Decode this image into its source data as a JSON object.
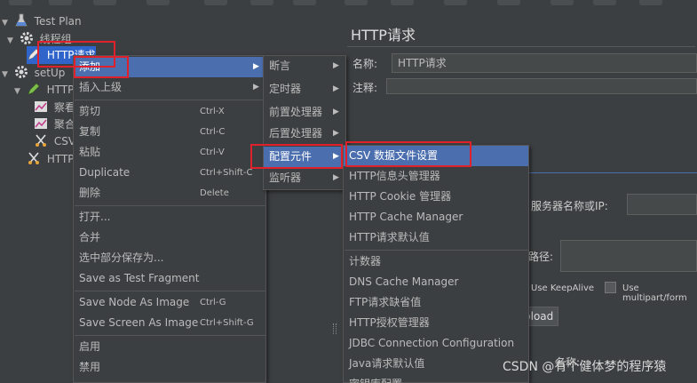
{
  "tree": {
    "items": [
      {
        "label": "Test Plan",
        "icon": "flask-icon"
      },
      {
        "label": "线程组",
        "icon": "gear-icon"
      },
      {
        "label": "HTTP请求",
        "icon": "pencil-icon"
      },
      {
        "label": "setUp",
        "icon": "gear-icon"
      },
      {
        "label": "HTTP",
        "icon": "pencil-icon"
      },
      {
        "label": "察看",
        "icon": "chart-icon"
      },
      {
        "label": "聚合",
        "icon": "chart-icon"
      },
      {
        "label": "CSV",
        "icon": "scissors-icon"
      },
      {
        "label": "HTTP",
        "icon": "scissors-icon"
      }
    ]
  },
  "detail": {
    "title": "HTTP请求",
    "name_label": "名称:",
    "name_value": "HTTP请求",
    "comment_label": "注释:",
    "server_label": "服务器名称或IP:",
    "path_label": "路径:",
    "keepalive_label": "Use KeepAlive",
    "multipart_label": "Use multipart/form",
    "upload_label": "pload",
    "bottom_label": "名称:"
  },
  "menu1": {
    "items": [
      {
        "label": "添加",
        "has_sub": true
      },
      {
        "label": "插入上级",
        "has_sub": true
      },
      {
        "label": "剪切",
        "shortcut": "Ctrl-X"
      },
      {
        "label": "复制",
        "shortcut": "Ctrl-C"
      },
      {
        "label": "粘贴",
        "shortcut": "Ctrl-V"
      },
      {
        "label": "Duplicate",
        "shortcut": "Ctrl+Shift-C"
      },
      {
        "label": "删除",
        "shortcut": "Delete"
      },
      {
        "label": "打开..."
      },
      {
        "label": "合并"
      },
      {
        "label": "选中部分保存为..."
      },
      {
        "label": "Save as Test Fragment"
      },
      {
        "label": "Save Node As Image",
        "shortcut": "Ctrl-G"
      },
      {
        "label": "Save Screen As Image",
        "shortcut": "Ctrl+Shift-G"
      },
      {
        "label": "启用"
      },
      {
        "label": "禁用"
      }
    ]
  },
  "menu2": {
    "items": [
      {
        "label": "断言"
      },
      {
        "label": "定时器"
      },
      {
        "label": "前置处理器"
      },
      {
        "label": "后置处理器"
      },
      {
        "label": "配置元件"
      },
      {
        "label": "监听器"
      }
    ]
  },
  "menu3": {
    "items": [
      {
        "label": "CSV 数据文件设置"
      },
      {
        "label": "HTTP信息头管理器"
      },
      {
        "label": "HTTP Cookie 管理器"
      },
      {
        "label": "HTTP Cache Manager"
      },
      {
        "label": "HTTP请求默认值"
      },
      {
        "label": "计数器"
      },
      {
        "label": "DNS Cache Manager"
      },
      {
        "label": "FTP请求缺省值"
      },
      {
        "label": "HTTP授权管理器"
      },
      {
        "label": "JDBC Connection Configuration"
      },
      {
        "label": "Java请求默认值"
      },
      {
        "label": "密钥库配置"
      }
    ]
  },
  "watermark": "CSDN @有个健体梦的程序猿",
  "colors": {
    "background": "#3c3f41",
    "highlight": "#4b6eaf",
    "selected": "#2f65ca",
    "annotation_red": "#e0202a"
  }
}
